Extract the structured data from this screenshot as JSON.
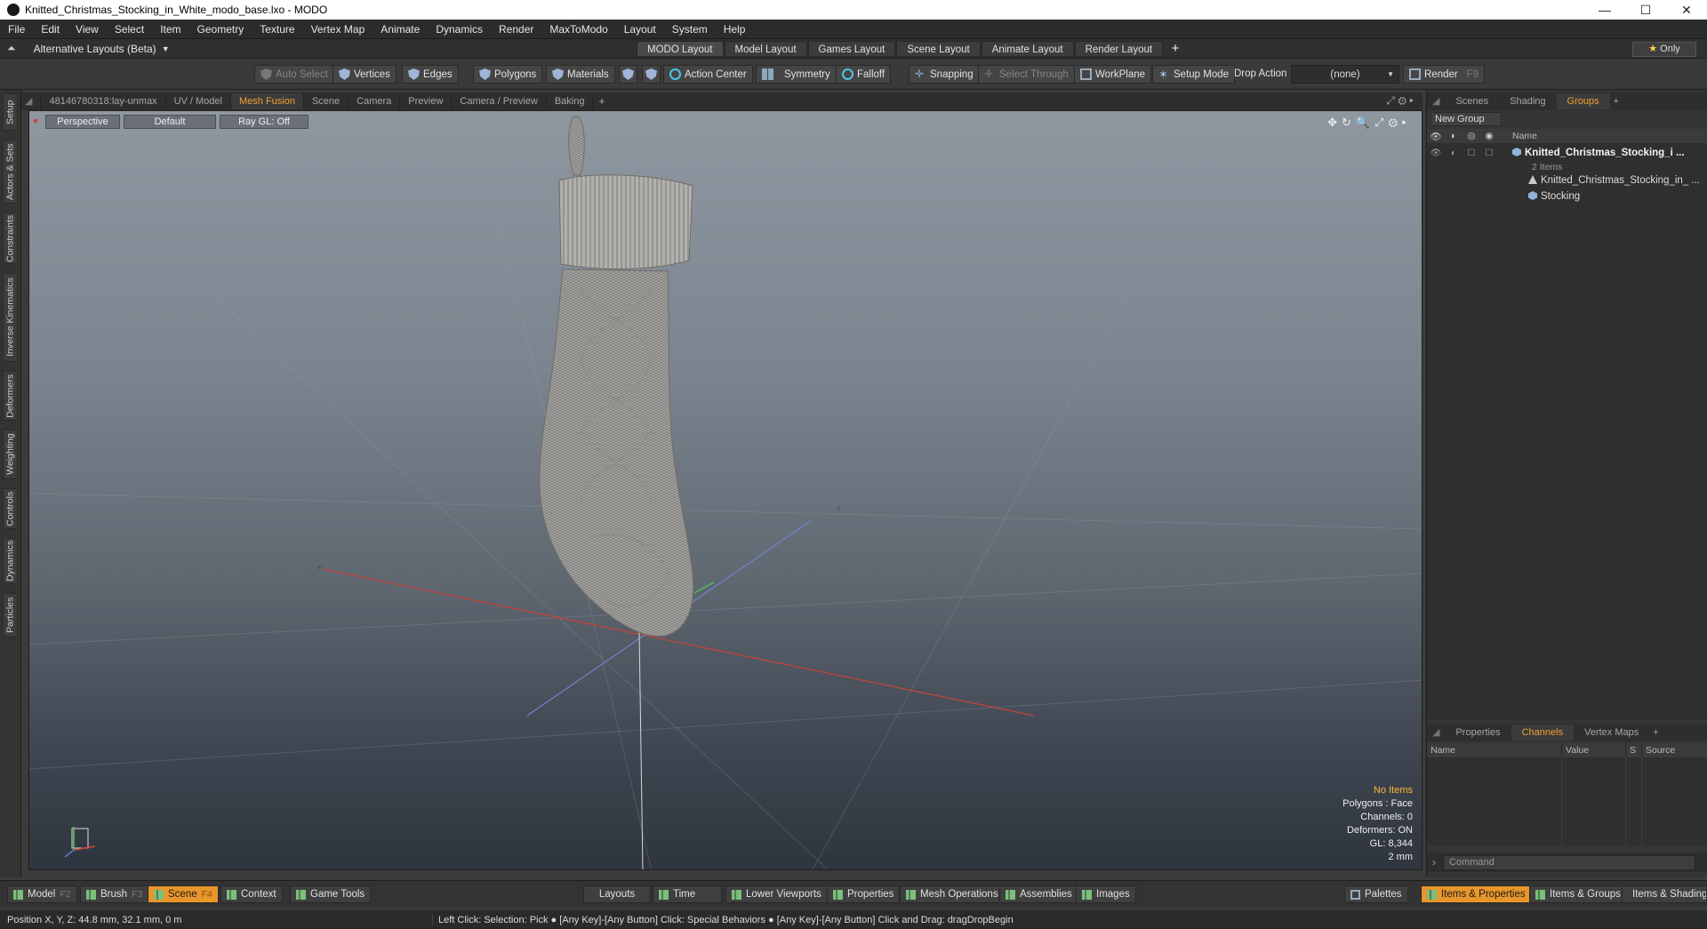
{
  "window": {
    "title": "Knitted_Christmas_Stocking_in_White_modo_base.lxo - MODO",
    "controls": [
      "—",
      "☐",
      "✕"
    ]
  },
  "menu": [
    "File",
    "Edit",
    "View",
    "Select",
    "Item",
    "Geometry",
    "Texture",
    "Vertex Map",
    "Animate",
    "Dynamics",
    "Render",
    "MaxToModo",
    "Layout",
    "System",
    "Help"
  ],
  "layoutbar": {
    "alt_layouts": "Alternative Layouts (Beta)",
    "tabs": [
      "MODO Layout",
      "Model Layout",
      "Games Layout",
      "Scene Layout",
      "Animate Layout",
      "Render Layout"
    ],
    "add": "+",
    "only": "Only"
  },
  "toolbar": {
    "auto_select": "Auto Select",
    "vertices": "Vertices",
    "edges": "Edges",
    "polygons": "Polygons",
    "materials": "Materials",
    "action_center": "Action Center",
    "symmetry": "Symmetry",
    "falloff": "Falloff",
    "snapping": "Snapping",
    "select_through": "Select Through",
    "workplane": "WorkPlane",
    "setup_mode": "Setup Mode",
    "drop_action_label": "Drop Action",
    "drop_action_value": "(none)",
    "render": "Render",
    "render_key": "F9"
  },
  "left_tabs": [
    "Setup",
    "Actors & Sets",
    "Constraints",
    "Inverse Kinematics",
    "Deformers",
    "Weighting",
    "Controls",
    "Dynamics",
    "Particles"
  ],
  "viewport_tabs": [
    "48146780318:lay-unmax",
    "UV / Model",
    "Mesh Fusion",
    "Scene",
    "Camera",
    "Preview",
    "Camera / Preview",
    "Baking"
  ],
  "viewport_tabs_active": "Mesh Fusion",
  "viewport": {
    "view": "Perspective",
    "shading": "Default",
    "raygl": "Ray GL: Off",
    "info": {
      "items": "No Items",
      "polygons": "Polygons : Face",
      "channels": "Channels: 0",
      "deformers": "Deformers: ON",
      "gl": "GL: 8,344",
      "scale": "2 mm"
    }
  },
  "right_panel": {
    "tabs": [
      "Scenes",
      "Shading",
      "Groups"
    ],
    "active_tab": "Groups",
    "new_group": "New Group",
    "name_col": "Name",
    "tree": {
      "group_name": "Knitted_Christmas_Stocking_i ...",
      "group_count": "2 Items",
      "child1": "Knitted_Christmas_Stocking_in_ ...",
      "child2": "Stocking"
    },
    "channel_tabs": [
      "Properties",
      "Channels",
      "Vertex Maps"
    ],
    "channel_active": "Channels",
    "channel_cols": [
      "Name",
      "Value",
      "S",
      "Source"
    ],
    "command_placeholder": "Command"
  },
  "bottombar": {
    "model": "Model",
    "model_key": "F2",
    "brush": "Brush",
    "brush_key": "F3",
    "scene": "Scene",
    "scene_key": "F4",
    "context": "Context",
    "game_tools": "Game Tools",
    "layouts": "Layouts",
    "time": "Time",
    "lower_viewports": "Lower Viewports",
    "properties": "Properties",
    "mesh_operations": "Mesh Operations",
    "assemblies": "Assemblies",
    "images": "Images",
    "palettes": "Palettes",
    "items_properties": "Items & Properties",
    "items_groups": "Items & Groups",
    "items_shading": "Items & Shading"
  },
  "status": {
    "position": "Position X, Y, Z:   44.8 mm, 32.1 mm, 0 m",
    "hint": "Left Click: Selection: Pick ● [Any Key]-[Any Button] Click: Special Behaviors ● [Any Key]-[Any Button] Click and Drag: dragDropBegin"
  },
  "colors": {
    "accent": "#e8962a",
    "active_tab_text": "#f0a030",
    "info_warn": "#ffb938"
  }
}
